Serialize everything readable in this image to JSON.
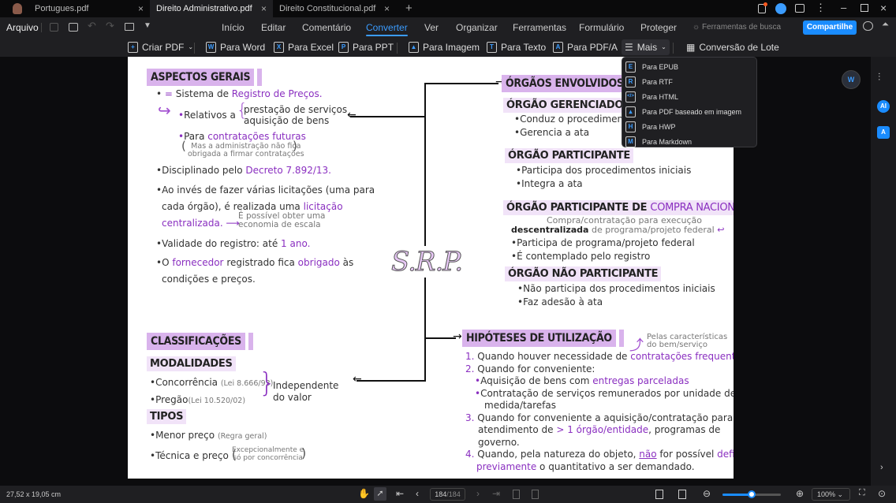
{
  "tabs": [
    {
      "label": "Portugues.pdf"
    },
    {
      "label": "Direito Administrativo.pdf",
      "active": true
    },
    {
      "label": "Direito Constitucional.pdf"
    }
  ],
  "menu": {
    "file": "Arquivo",
    "items": [
      "Início",
      "Editar",
      "Comentário",
      "Converter",
      "Ver",
      "Organizar",
      "Ferramentas",
      "Formulário",
      "Proteger"
    ],
    "active": "Converter",
    "search_tools": "Ferramentas de busca",
    "share": "Compartilhe"
  },
  "toolbar": {
    "create_pdf": "Criar PDF",
    "to_word": "Para Word",
    "to_excel": "Para Excel",
    "to_ppt": "Para PPT",
    "to_image": "Para Imagem",
    "to_text": "Para Texto",
    "to_pdfa": "Para PDF/A",
    "more": "Mais",
    "batch": "Conversão de Lote"
  },
  "dropdown": [
    {
      "icon": "E",
      "label": "Para EPUB"
    },
    {
      "icon": "R",
      "label": "Para RTF"
    },
    {
      "icon": "</>",
      "label": "Para HTML"
    },
    {
      "icon": "img",
      "label": "Para PDF baseado em imagem"
    },
    {
      "icon": "H",
      "label": "Para HWP"
    },
    {
      "icon": "M",
      "label": "Para Markdown"
    }
  ],
  "doc": {
    "center": "S.R.P.",
    "aspectos": {
      "title": "ASPECTOS GERAIS",
      "eq": "=",
      "l1a": "Sistema de ",
      "l1b": "Registro de Preços.",
      "rel": "Relativos a",
      "rel1": "prestação de serviços",
      "rel2": "aquisição de bens",
      "fut_a": "Para ",
      "fut_b": "contratações futuras",
      "note1": "Mas a administração não fica",
      "note2": "obrigada a firmar contratações",
      "dec_a": "Disciplinado pelo ",
      "dec_b": "Decreto 7.892/13.",
      "inv1": "Ao invés de fazer várias licitações (uma para",
      "inv2a": "cada órgão), é realizada uma ",
      "inv2b": "licitação",
      "inv3": "centralizada.",
      "eco1": "É possível obter uma",
      "eco2": "economia de escala",
      "val_a": "Validade do registro: até ",
      "val_b": "1 ano.",
      "for_a": "O ",
      "for_b": "fornecedor",
      "for_c": " registrado fica ",
      "for_d": "obrigado",
      "for_e": " às",
      "for2": "condições e preços."
    },
    "orgaos": {
      "title": "ÓRGÃOS ENVOLVIDOS",
      "ger": "ÓRGÃO GERENCIADOR",
      "ger1": "Conduz o procedimento",
      "ger2": "Gerencia a ata",
      "par": "ÓRGÃO PARTICIPANTE",
      "par1": "Participa dos procedimentos iniciais",
      "par2": "Integra a ata",
      "nac_a": "ÓRGÃO PARTICIPANTE DE ",
      "nac_b": "COMPRA NACIONAL",
      "nacn1": "Compra/contratação para execução",
      "nacn2a": "descentralizada",
      "nacn2b": " de programa/projeto federal",
      "nac1": "Participa de programa/projeto federal",
      "nac2": "É contemplado pelo registro",
      "nao": "ÓRGÃO NÃO PARTICIPANTE",
      "nao1": "Não participa dos procedimentos iniciais",
      "nao2": "Faz adesão à ata"
    },
    "classif": {
      "title": "CLASSIFICAÇÕES",
      "mod": "MODALIDADES",
      "c1": "Concorrência",
      "c1s": "(Lei 8.666/93)",
      "c2": "Pregão",
      "c2s": "(Lei 10.520/02)",
      "ind1": "Independente",
      "ind2": "do valor",
      "tipos": "TIPOS",
      "t1": "Menor preço",
      "t1s": "(Regra geral)",
      "t2": "Técnica e preço",
      "t2s1": "Excepcionalmente e",
      "t2s2": "só por concorrência"
    },
    "hip": {
      "title": "HIPÓTESES DE UTILIZAÇÃO",
      "note1": "Pelas características",
      "note2": "do bem/serviço",
      "h1n": "1.",
      "h1a": "Quando houver necessidade de ",
      "h1b": "contratações frequentes",
      "h1c": ".",
      "h2n": "2.",
      "h2": "Quando for conveniente:",
      "h2a_a": "Aquisição de bens com ",
      "h2a_b": "entregas parceladas",
      "h2b1": "Contratação de serviços remunerados por unidade de",
      "h2b2": "medida/tarefas",
      "h3n": "3.",
      "h3": "Quando for conveniente a aquisição/contratação para",
      "h3b_a": "atendimento de ",
      "h3b_b": "> 1 órgão/entidade",
      "h3b_c": ", programas de",
      "h3c": "governo.",
      "h4n": "4.",
      "h4a": "Quando, pela natureza do objeto, ",
      "h4b": "não",
      "h4c": " for possível ",
      "h4d": "definir",
      "h4e": "previamente",
      "h4f": " o quantitativo a ser demandado."
    }
  },
  "status": {
    "dimensions": "27,52 x 19,05 cm",
    "page_current": "184",
    "page_total": "/184",
    "zoom": "100%",
    "zoom_slider": 0.5
  },
  "colors": {
    "accent": "#3b9cff",
    "highlight": "#d9b3ec",
    "purple_text": "#8a2fc0"
  }
}
